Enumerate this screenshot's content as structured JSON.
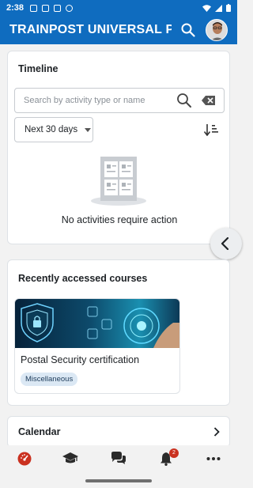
{
  "status_bar": {
    "time": "2:38"
  },
  "app_bar": {
    "title": "TRAINPOST UNIVERSAL P..."
  },
  "timeline": {
    "title": "Timeline",
    "search_placeholder": "Search by activity type or name",
    "filter_selected": "Next 30 days",
    "empty_message": "No activities require action"
  },
  "recent_courses": {
    "title": "Recently accessed courses",
    "courses": [
      {
        "name": "Postal Security certification",
        "category": "Miscellaneous"
      }
    ]
  },
  "calendar": {
    "title": "Calendar"
  },
  "bottom_nav": {
    "tabs": [
      {
        "name": "dashboard",
        "icon": "dashboard-icon"
      },
      {
        "name": "courses",
        "icon": "graduation-cap-icon"
      },
      {
        "name": "messages",
        "icon": "chat-bubbles-icon"
      },
      {
        "name": "notifications",
        "icon": "bell-icon"
      },
      {
        "name": "more",
        "icon": "more-dots-icon"
      }
    ],
    "notification_count": "2"
  },
  "colors": {
    "brand": "#0f6cbf",
    "active_tab": "#ca3120"
  }
}
